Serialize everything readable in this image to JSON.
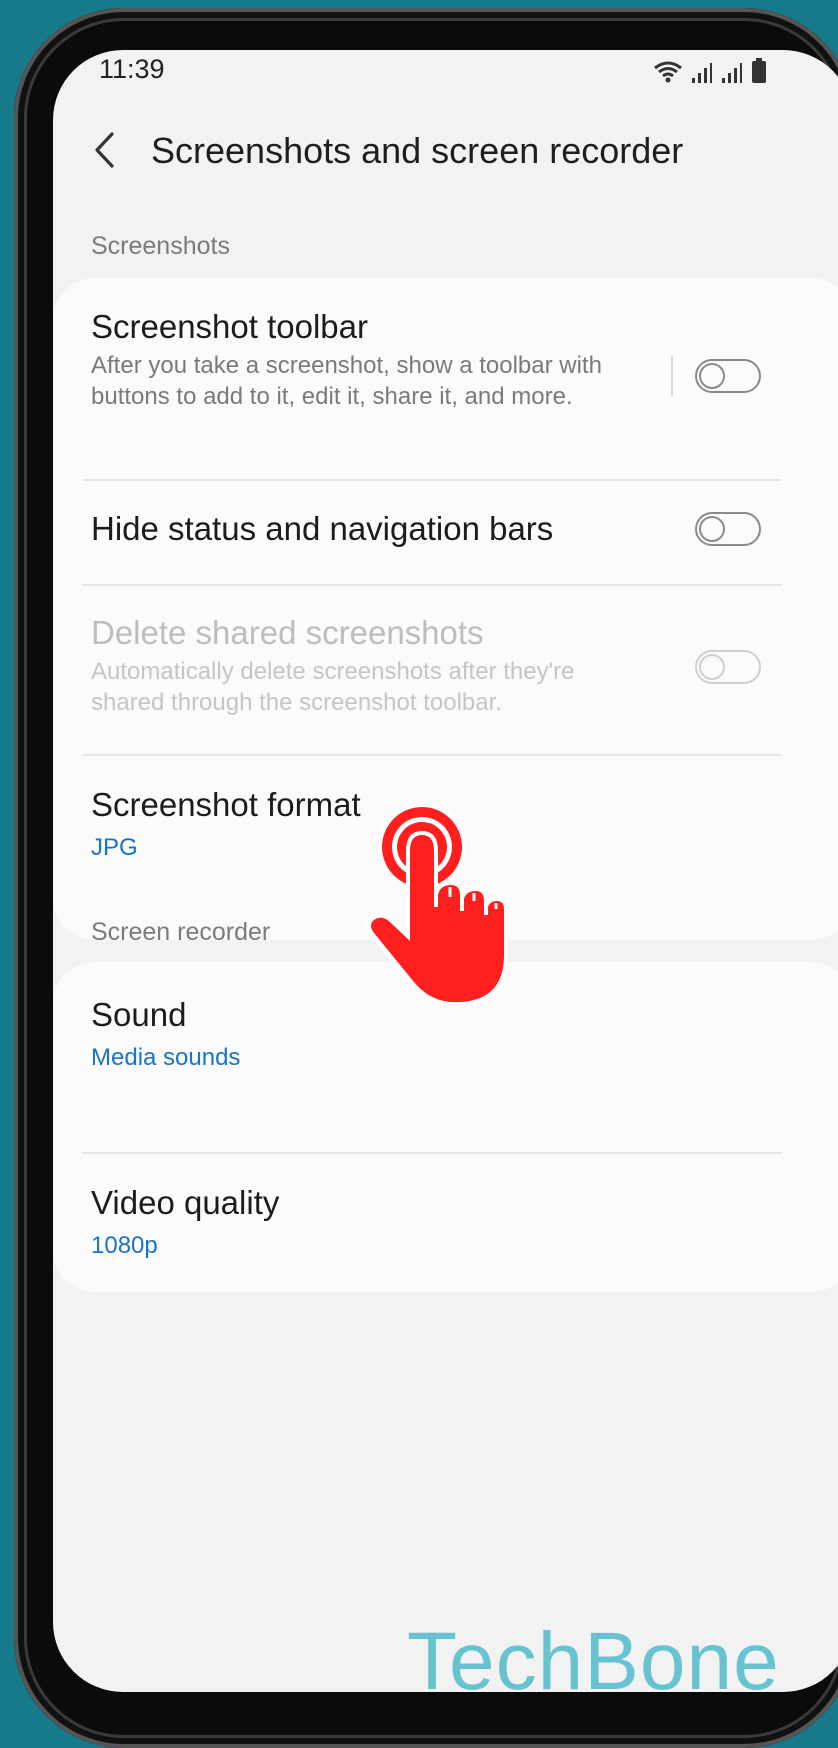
{
  "status_bar": {
    "time": "11:39",
    "icons": [
      "wifi-icon",
      "signal-icon",
      "signal-icon",
      "battery-icon"
    ]
  },
  "header": {
    "back_icon": "chevron-left-icon",
    "title": "Screenshots and screen recorder"
  },
  "sections": {
    "screenshots": {
      "label": "Screenshots",
      "items": [
        {
          "title": "Screenshot toolbar",
          "subtitle": "After you take a screenshot, show a toolbar with buttons to add to it, edit it, share it, and more.",
          "toggle": "off"
        },
        {
          "title": "Hide status and navigation bars",
          "toggle": "off"
        },
        {
          "title": "Delete shared screenshots",
          "subtitle": "Automatically delete screenshots after they're shared through the screenshot toolbar.",
          "toggle": "off",
          "disabled": true
        },
        {
          "title": "Screenshot format",
          "value": "JPG"
        }
      ]
    },
    "screen_recorder": {
      "label": "Screen recorder",
      "items": [
        {
          "title": "Sound",
          "value": "Media sounds"
        },
        {
          "title": "Video quality",
          "value": "1080p"
        }
      ]
    }
  },
  "overlay": {
    "tap_indicator_icon": "tap-hand-icon"
  },
  "watermark": "TechBone",
  "colors": {
    "accent": "#1a73c8",
    "background": "#177a8a",
    "tap_indicator": "#ff1f1f",
    "watermark": "#67c3cf"
  }
}
